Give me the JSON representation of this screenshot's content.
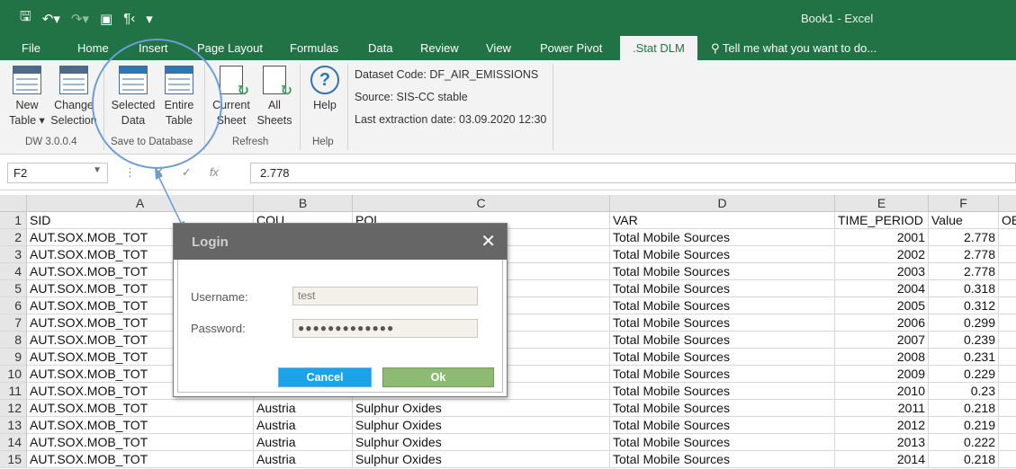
{
  "title_bar": {
    "window_title": "Book1 - Excel",
    "icons": [
      "save-icon",
      "undo-icon",
      "redo-icon",
      "view-icon",
      "paragraph-icon",
      "customize-icon"
    ]
  },
  "tabs": [
    "File",
    "Home",
    "Insert",
    "Page Layout",
    "Formulas",
    "Data",
    "Review",
    "View",
    "Power Pivot",
    ".Stat DLM"
  ],
  "tell_me": "Tell me what you want to do...",
  "ribbon": {
    "new_table": [
      "New",
      "Table"
    ],
    "change_selection": [
      "Change",
      "Selection"
    ],
    "group_dw": "DW 3.0.0.4",
    "selected_data": [
      "Selected",
      "Data"
    ],
    "entire_table": [
      "Entire",
      "Table"
    ],
    "group_save": "Save to Database",
    "current_sheet": [
      "Current",
      "Sheet"
    ],
    "all_sheets": [
      "All",
      "Sheets"
    ],
    "group_refresh": "Refresh",
    "help": "Help",
    "group_help": "Help",
    "dataset_code": "Dataset Code: DF_AIR_EMISSIONS",
    "source": "Source: SIS-CC stable",
    "last_extraction": "Last extraction date: 03.09.2020 12:30"
  },
  "formula_bar": {
    "cell_ref": "F2",
    "fx": "fx",
    "value": "2.778"
  },
  "columns": [
    "A",
    "B",
    "C",
    "D",
    "E",
    "F"
  ],
  "header_row": [
    "SID",
    "COU",
    "POL",
    "VAR",
    "TIME_PERIOD",
    "Value",
    "OB"
  ],
  "rows": [
    [
      "AUT.SOX.MOB_TOT",
      "",
      "",
      "Total Mobile Sources",
      "2001",
      "2.778"
    ],
    [
      "AUT.SOX.MOB_TOT",
      "",
      "",
      "Total Mobile Sources",
      "2002",
      "2.778"
    ],
    [
      "AUT.SOX.MOB_TOT",
      "",
      "",
      "Total Mobile Sources",
      "2003",
      "2.778"
    ],
    [
      "AUT.SOX.MOB_TOT",
      "",
      "",
      "Total Mobile Sources",
      "2004",
      "0.318"
    ],
    [
      "AUT.SOX.MOB_TOT",
      "",
      "",
      "Total Mobile Sources",
      "2005",
      "0.312"
    ],
    [
      "AUT.SOX.MOB_TOT",
      "",
      "",
      "Total Mobile Sources",
      "2006",
      "0.299"
    ],
    [
      "AUT.SOX.MOB_TOT",
      "",
      "",
      "Total Mobile Sources",
      "2007",
      "0.239"
    ],
    [
      "AUT.SOX.MOB_TOT",
      "",
      "",
      "Total Mobile Sources",
      "2008",
      "0.231"
    ],
    [
      "AUT.SOX.MOB_TOT",
      "",
      "",
      "Total Mobile Sources",
      "2009",
      "0.229"
    ],
    [
      "AUT.SOX.MOB_TOT",
      "",
      "",
      "Total Mobile Sources",
      "2010",
      "0.23"
    ],
    [
      "AUT.SOX.MOB_TOT",
      "Austria",
      "Sulphur Oxides",
      "Total Mobile Sources",
      "2011",
      "0.218"
    ],
    [
      "AUT.SOX.MOB_TOT",
      "Austria",
      "Sulphur Oxides",
      "Total Mobile Sources",
      "2012",
      "0.219"
    ],
    [
      "AUT.SOX.MOB_TOT",
      "Austria",
      "Sulphur Oxides",
      "Total Mobile Sources",
      "2013",
      "0.222"
    ],
    [
      "AUT.SOX.MOB_TOT",
      "Austria",
      "Sulphur Oxides",
      "Total Mobile Sources",
      "2014",
      "0.218"
    ]
  ],
  "dialog": {
    "title": "Login",
    "username_label": "Username:",
    "username_value": "test",
    "password_label": "Password:",
    "password_value": "●●●●●●●●●●●●●",
    "cancel": "Cancel",
    "ok": "Ok"
  },
  "colors": {
    "excel_green": "#217346",
    "cancel_button": "#1aa3e8",
    "ok_button": "#8dbb73",
    "callout": "#6b9ed6"
  }
}
